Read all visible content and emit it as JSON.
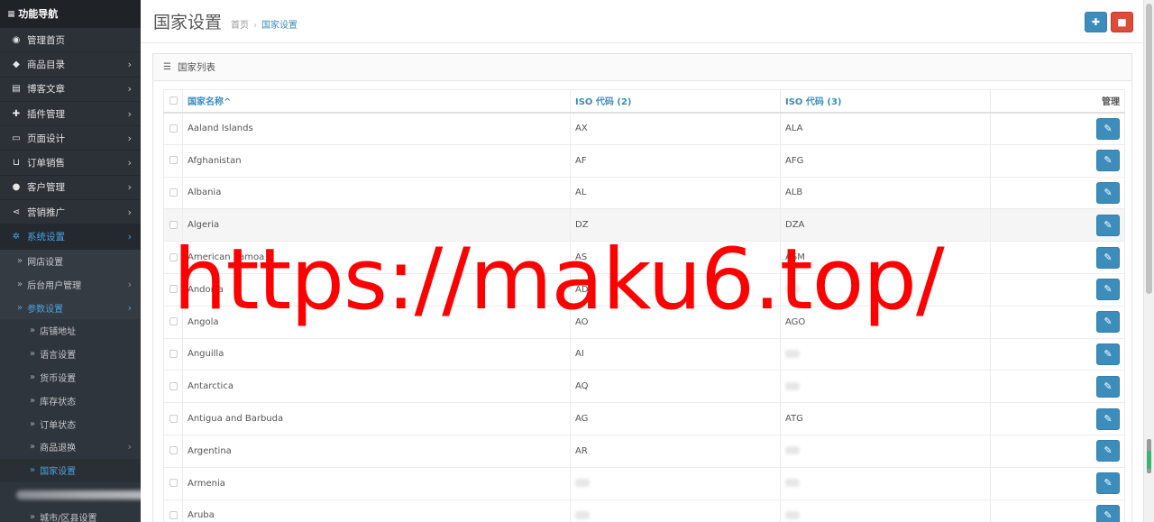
{
  "sidebar": {
    "title": "功能导航",
    "items": [
      {
        "label": "管理首页",
        "icon": "dashboard-icon",
        "glyph": "◉",
        "has_children": false
      },
      {
        "label": "商品目录",
        "icon": "tag-icon",
        "glyph": "◆",
        "has_children": true
      },
      {
        "label": "博客文章",
        "icon": "newspaper-icon",
        "glyph": "▤",
        "has_children": true
      },
      {
        "label": "插件管理",
        "icon": "puzzle-icon",
        "glyph": "✚",
        "has_children": true
      },
      {
        "label": "页面设计",
        "icon": "desktop-icon",
        "glyph": "▭",
        "has_children": true
      },
      {
        "label": "订单销售",
        "icon": "cart-icon",
        "glyph": "⊔",
        "has_children": true
      },
      {
        "label": "客户管理",
        "icon": "user-icon",
        "glyph": "●",
        "has_children": true
      },
      {
        "label": "营销推广",
        "icon": "share-icon",
        "glyph": "⋖",
        "has_children": true
      },
      {
        "label": "系统设置",
        "icon": "gear-icon",
        "glyph": "✲",
        "has_children": true
      }
    ],
    "system_sub": [
      {
        "label": "网店设置",
        "has_children": false
      },
      {
        "label": "后台用户管理",
        "has_children": true
      },
      {
        "label": "参数设置",
        "has_children": true
      }
    ],
    "param_sub": [
      {
        "label": "店铺地址",
        "has_children": false
      },
      {
        "label": "语言设置",
        "has_children": false
      },
      {
        "label": "货币设置",
        "has_children": false
      },
      {
        "label": "库存状态",
        "has_children": false
      },
      {
        "label": "订单状态",
        "has_children": false
      },
      {
        "label": "商品退换",
        "has_children": true
      },
      {
        "label": "国家设置",
        "has_children": false
      }
    ],
    "bottom_item": "城市/区县设置"
  },
  "header": {
    "title": "国家设置",
    "breadcrumb": [
      "首页",
      "国家设置"
    ],
    "add_icon": "plus-icon",
    "delete_icon": "trash-icon"
  },
  "panel": {
    "title": "国家列表",
    "icon": "list-icon"
  },
  "table": {
    "columns": [
      "国家名称",
      "ISO 代码 (2)",
      "ISO 代码 (3)",
      "管理"
    ],
    "sort_indicator": "^",
    "rows": [
      {
        "name": "Aaland Islands",
        "iso2": "AX",
        "iso3": "ALA"
      },
      {
        "name": "Afghanistan",
        "iso2": "AF",
        "iso3": "AFG"
      },
      {
        "name": "Albania",
        "iso2": "AL",
        "iso3": "ALB"
      },
      {
        "name": "Algeria",
        "iso2": "DZ",
        "iso3": "DZA"
      },
      {
        "name": "American Samoa",
        "iso2": "AS",
        "iso3": "ASM"
      },
      {
        "name": "Andorra",
        "iso2": "AD",
        "iso3": ""
      },
      {
        "name": "Angola",
        "iso2": "AO",
        "iso3": "AGO"
      },
      {
        "name": "Anguilla",
        "iso2": "AI",
        "iso3": ""
      },
      {
        "name": "Antarctica",
        "iso2": "AQ",
        "iso3": ""
      },
      {
        "name": "Antigua and Barbuda",
        "iso2": "AG",
        "iso3": "ATG"
      },
      {
        "name": "Argentina",
        "iso2": "AR",
        "iso3": ""
      },
      {
        "name": "Armenia",
        "iso2": "",
        "iso3": ""
      },
      {
        "name": "Aruba",
        "iso2": "",
        "iso3": ""
      }
    ]
  },
  "watermark": "https://maku6.top/",
  "colors": {
    "accent": "#3c8dbc",
    "danger": "#dd4b39",
    "sidebar_bg": "#2c3138",
    "watermark": "#ff0000"
  }
}
